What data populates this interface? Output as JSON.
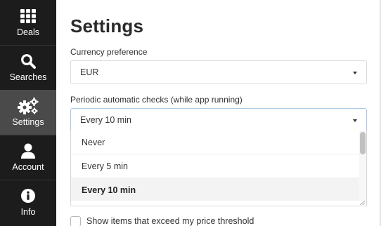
{
  "sidebar": {
    "items": [
      {
        "label": "Deals",
        "icon": "grid-icon",
        "active": false
      },
      {
        "label": "Searches",
        "icon": "search-icon",
        "active": false
      },
      {
        "label": "Settings",
        "icon": "gears-icon",
        "active": true
      },
      {
        "label": "Account",
        "icon": "user-icon",
        "active": false
      },
      {
        "label": "Info",
        "icon": "info-circle-icon",
        "active": false
      }
    ]
  },
  "settings": {
    "title": "Settings",
    "currency": {
      "label": "Currency preference",
      "value": "EUR"
    },
    "periodic_checks": {
      "label": "Periodic automatic checks (while app running)",
      "value": "Every 10 min",
      "options": [
        "Never",
        "Every 5 min",
        "Every 10 min"
      ],
      "selected_index": 2
    },
    "price_threshold_checkbox": {
      "label": "Show items that exceed my price threshold",
      "checked": false
    }
  },
  "colors": {
    "sidebar_bg": "#1c1c1c",
    "sidebar_active_bg": "#4a4a4a",
    "focus_border": "#aac9e6"
  }
}
